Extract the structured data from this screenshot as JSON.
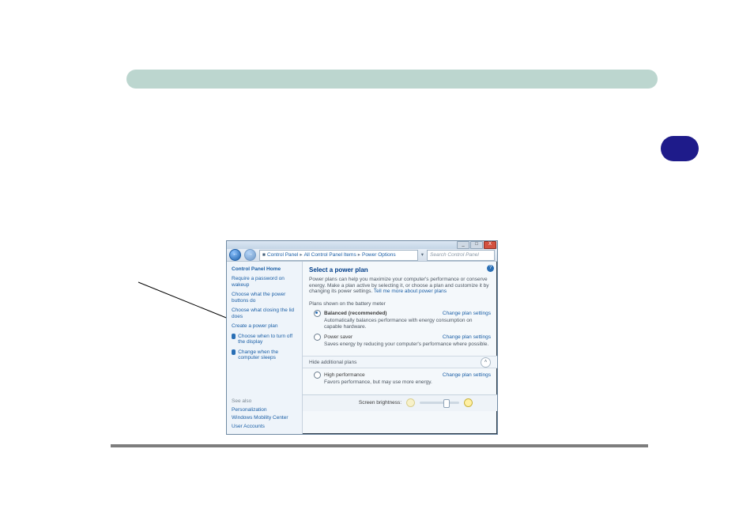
{
  "breadcrumb": [
    "Control Panel",
    "All Control Panel Items",
    "Power Options"
  ],
  "search_placeholder": "Search Control Panel",
  "sidebar": {
    "home": "Control Panel Home",
    "links": [
      "Require a password on wakeup",
      "Choose what the power buttons do",
      "Choose what closing the lid does",
      "Create a power plan",
      "Choose when to turn off the display",
      "Change when the computer sleeps"
    ],
    "seealso_hdr": "See also",
    "seealso": [
      "Personalization",
      "Windows Mobility Center",
      "User Accounts"
    ]
  },
  "main": {
    "title": "Select a power plan",
    "intro": "Power plans can help you maximize your computer's performance or conserve energy. Make a plan active by selecting it, or choose a plan and customize it by changing its power settings.",
    "intro_link": "Tell me more about power plans",
    "shown_hdr": "Plans shown on the battery meter",
    "plans": [
      {
        "name": "Balanced (recommended)",
        "desc": "Automatically balances performance with energy consumption on capable hardware.",
        "change": "Change plan settings",
        "selected": true
      },
      {
        "name": "Power saver",
        "desc": "Saves energy by reducing your computer's performance where possible.",
        "change": "Change plan settings",
        "selected": false
      }
    ],
    "hide_hdr": "Hide additional plans",
    "extra": {
      "name": "High performance",
      "desc": "Favors performance, but may use more energy.",
      "change": "Change plan settings",
      "selected": false
    },
    "brightness_label": "Screen brightness:"
  },
  "winbuttons": {
    "min": "_",
    "max": "□",
    "close": "X"
  }
}
